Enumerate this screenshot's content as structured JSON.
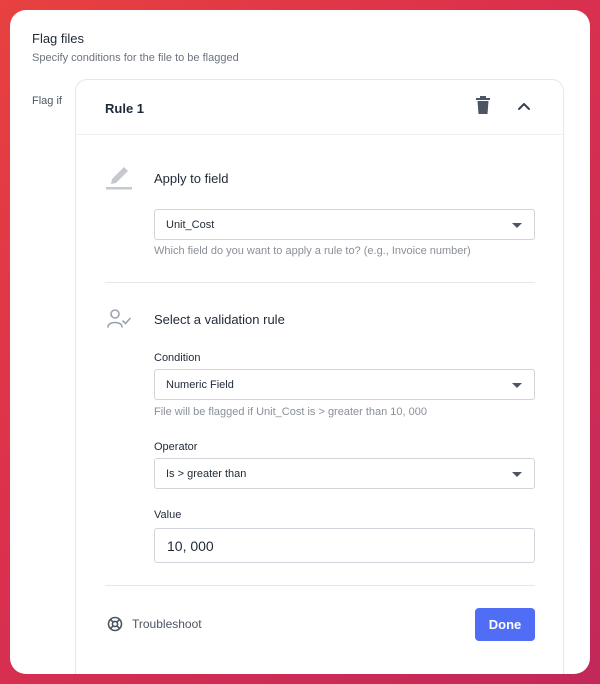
{
  "modal": {
    "title": "Flag files",
    "subtitle": "Specify conditions for the file to be flagged",
    "flag_if_label": "Flag if"
  },
  "rule": {
    "title": "Rule 1",
    "icons": {
      "delete": "trash-icon",
      "collapse": "chevron-up-icon"
    }
  },
  "apply_field": {
    "icon": "pencil-icon",
    "title": "Apply to field",
    "selected": "Unit_Cost",
    "helper": "Which field do you want to apply a rule to? (e.g., Invoice number)"
  },
  "validation": {
    "icon": "user-check-icon",
    "title": "Select a validation rule",
    "condition_label": "Condition",
    "condition_value": "Numeric Field",
    "condition_helper": "File will be flagged if Unit_Cost is > greater than 10, 000",
    "operator_label": "Operator",
    "operator_value": "Is > greater than",
    "value_label": "Value",
    "value_input": "10, 000"
  },
  "footer": {
    "troubleshoot_label": "Troubleshoot",
    "troubleshoot_icon": "lifebuoy-icon",
    "done_label": "Done"
  },
  "colors": {
    "background_gradient": [
      "#e8413f",
      "#c2285a"
    ],
    "primary_button": "#4f6df5"
  }
}
